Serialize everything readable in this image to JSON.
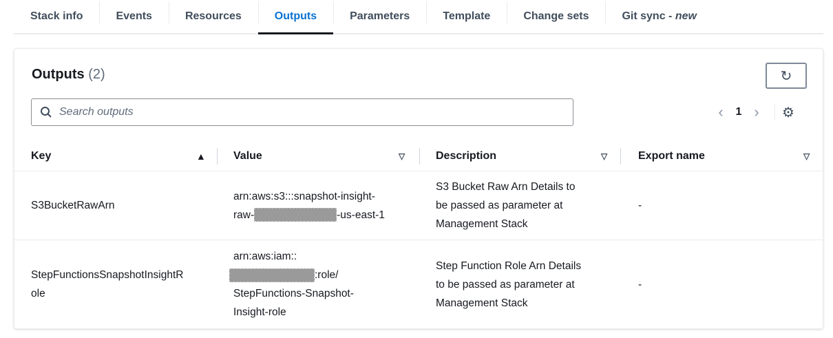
{
  "tabs": [
    "Stack info",
    "Events",
    "Resources",
    "Outputs",
    "Parameters",
    "Template",
    "Change sets"
  ],
  "git_tab": {
    "label": "Git sync - ",
    "badge": "new"
  },
  "panel": {
    "title": "Outputs",
    "count": "(2)"
  },
  "search": {
    "placeholder": "Search outputs"
  },
  "pager": {
    "page": "1"
  },
  "columns": [
    "Key",
    "Value",
    "Description",
    "Export name"
  ],
  "rows": [
    {
      "key": "S3BucketRawArn",
      "value_a": "arn:aws:s3:::snapshot-insight-",
      "value_b": "raw-",
      "value_c": "-us-east-1",
      "desc_1": "S3 Bucket Raw Arn Details to",
      "desc_2": "be passed as parameter at",
      "desc_3": "Management Stack",
      "export": "-"
    },
    {
      "key_1": "StepFunctionsSnapshotInsightR",
      "key_2": "ole",
      "value_a": "arn:aws:iam::",
      "value_b": ":role/",
      "value_c": "StepFunctions-Snapshot-",
      "value_d": "Insight-role",
      "desc_1": "Step Function Role Arn Details",
      "desc_2": "to be passed as parameter at",
      "desc_3": "Management Stack",
      "export": "-"
    }
  ]
}
